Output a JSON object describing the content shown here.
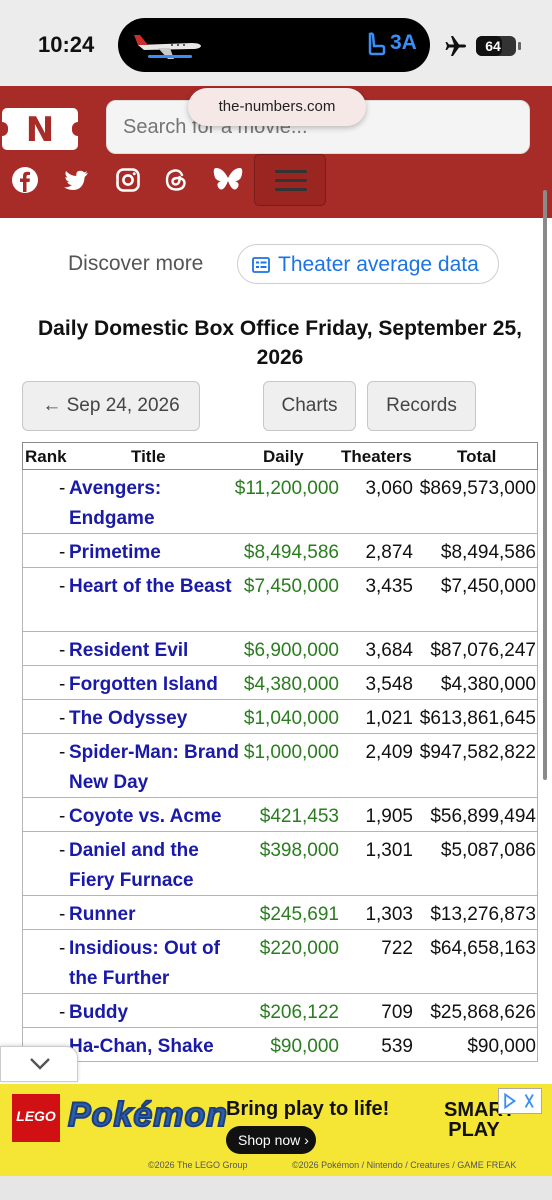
{
  "status_bar": {
    "time": "10:24",
    "seat": "3A",
    "battery": "64",
    "battery_level": 0.64
  },
  "browser": {
    "url": "the-numbers.com"
  },
  "header": {
    "logo_letter": "N",
    "search_placeholder": "Search for a movie..."
  },
  "discover": {
    "label": "Discover more",
    "link": "Theater average data"
  },
  "page_title": "Daily Domestic Box Office Friday, September 25, 2026",
  "nav": {
    "prev": "← Sep 24, 2026",
    "charts": "Charts",
    "records": "Records"
  },
  "table": {
    "headers": {
      "rank": "Rank",
      "title": "Title",
      "daily": "Daily",
      "theaters": "Theaters",
      "total": "Total"
    },
    "rows": [
      {
        "dash": "-",
        "title": "Avengers: Endgame",
        "daily": "$11,200,000",
        "theaters": "3,060",
        "total": "$869,573,000"
      },
      {
        "dash": "-",
        "title": "Primetime",
        "daily": "$8,494,586",
        "theaters": "2,874",
        "total": "$8,494,586"
      },
      {
        "dash": "-",
        "title": "Heart of the Beast",
        "daily": "$7,450,000",
        "theaters": "3,435",
        "total": "$7,450,000"
      },
      {
        "dash": "-",
        "title": "Resident Evil",
        "daily": "$6,900,000",
        "theaters": "3,684",
        "total": "$87,076,247"
      },
      {
        "dash": "-",
        "title": "Forgotten Island",
        "daily": "$4,380,000",
        "theaters": "3,548",
        "total": "$4,380,000"
      },
      {
        "dash": "-",
        "title": "The Odyssey",
        "daily": "$1,040,000",
        "theaters": "1,021",
        "total": "$613,861,645"
      },
      {
        "dash": "-",
        "title": "Spider-Man: Brand New Day",
        "daily": "$1,000,000",
        "theaters": "2,409",
        "total": "$947,582,822"
      },
      {
        "dash": "-",
        "title": "Coyote vs. Acme",
        "daily": "$421,453",
        "theaters": "1,905",
        "total": "$56,899,494"
      },
      {
        "dash": "-",
        "title": "Daniel and the Fiery Furnace",
        "daily": "$398,000",
        "theaters": "1,301",
        "total": "$5,087,086"
      },
      {
        "dash": "-",
        "title": "Runner",
        "daily": "$245,691",
        "theaters": "1,303",
        "total": "$13,276,873"
      },
      {
        "dash": "-",
        "title": "Insidious: Out of the Further",
        "daily": "$220,000",
        "theaters": "722",
        "total": "$64,658,163"
      },
      {
        "dash": "-",
        "title": "Buddy",
        "daily": "$206,122",
        "theaters": "709",
        "total": "$25,868,626"
      },
      {
        "dash": "",
        "title": "Ha-Chan, Shake",
        "daily": "$90,000",
        "theaters": "539",
        "total": "$90,000"
      }
    ]
  },
  "ad": {
    "lego": "LEGO",
    "pokemon": "Pokémon",
    "headline": "Bring play to life!",
    "cta": "Shop now ›",
    "brand": "SMART PLAY",
    "legal_left": "©2026 The LEGO Group",
    "legal_right": "©2026 Pokémon / Nintendo / Creatures / GAME FREAK"
  },
  "colors": {
    "header_red": "#a72b27",
    "link_blue": "#1a1aa8",
    "money_green": "#2a7d1f",
    "ad_yellow": "#f5e535"
  }
}
